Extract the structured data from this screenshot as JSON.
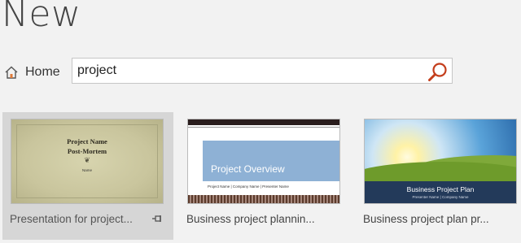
{
  "title": "New",
  "nav": {
    "home_label": "Home"
  },
  "search": {
    "value": "project"
  },
  "templates": [
    {
      "caption": "Presentation for project...",
      "thumb": {
        "line1": "Project Name",
        "line2": "Post-Mortem",
        "ornament": "❦",
        "line3": "Name"
      }
    },
    {
      "caption": "Business project plannin...",
      "thumb": {
        "title": "Project Overview",
        "subtitle": "Project Name | Company Name | Presenter Name"
      }
    },
    {
      "caption": "Business project plan pr...",
      "thumb": {
        "title": "Business Project Plan",
        "subtitle": "Presenter Name | Company Name"
      }
    }
  ],
  "colors": {
    "accent": "#c43e1c",
    "background": "#f2f2f2"
  }
}
